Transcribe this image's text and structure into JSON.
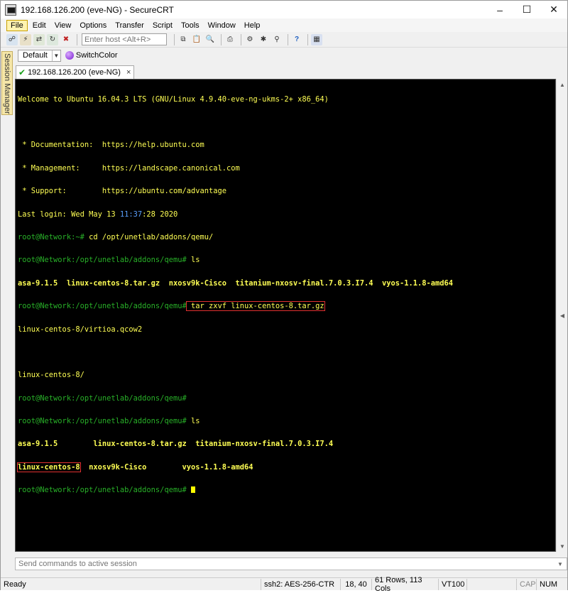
{
  "window": {
    "title": "192.168.126.200 (eve-NG) - SecureCRT"
  },
  "menu": [
    "File",
    "Edit",
    "View",
    "Options",
    "Transfer",
    "Script",
    "Tools",
    "Window",
    "Help"
  ],
  "toolbar": {
    "host_placeholder": "Enter host <Alt+R>"
  },
  "buttonbar": {
    "default_label": "Default",
    "switchcolor_label": "SwitchColor"
  },
  "session_manager": {
    "label": "Session Manager"
  },
  "tab": {
    "label": "192.168.126.200 (eve-NG)",
    "close": "×"
  },
  "terminal": {
    "l1": "Welcome to Ubuntu 16.04.3 LTS (GNU/Linux 4.9.40-eve-ng-ukms-2+ x86_64)",
    "l3": " * Documentation:  https://help.ubuntu.com",
    "l4": " * Management:     https://landscape.canonical.com",
    "l5": " * Support:        https://ubuntu.com/advantage",
    "l6a": "Last login: Wed May 13 ",
    "l6b": "11:37",
    "l6c": ":28 2020",
    "prompt_home": "root@Network:~#",
    "cmd_cd": " cd /opt/unetlab/addons/qemu/",
    "prompt_qemu": "root@Network:/opt/unetlab/addons/qemu#",
    "cmd_ls": " ls",
    "ls1": "asa-9.1.5  linux-centos-8.tar.gz  nxosv9k-Cisco  titanium-nxosv-final.7.0.3.I7.4  vyos-1.1.8-amd64",
    "cmd_tar": " tar zxvf linux-centos-8.tar.gz",
    "out_tar": "linux-centos-8/virtioa.qcow2",
    "out_dir": "linux-centos-8/",
    "ls2_r1": "asa-9.1.5        linux-centos-8.tar.gz  titanium-nxosv-final.7.0.3.I7.4",
    "ls2_r2a": "linux-centos-8",
    "ls2_r2b": "  nxosv9k-Cisco        vyos-1.1.8-amd64"
  },
  "send_commands": {
    "placeholder": "Send commands to active session"
  },
  "status": {
    "ready": "Ready",
    "cipher": "ssh2: AES-256-CTR",
    "position": "18,  40",
    "size": "61 Rows, 113 Cols",
    "emulation": "VT100",
    "cap": "CAP",
    "num": "NUM"
  },
  "colors": {
    "terminal_bg": "#000000",
    "terminal_fg": "#ffff54",
    "prompt": "#28b028",
    "highlight": "#e03030"
  }
}
